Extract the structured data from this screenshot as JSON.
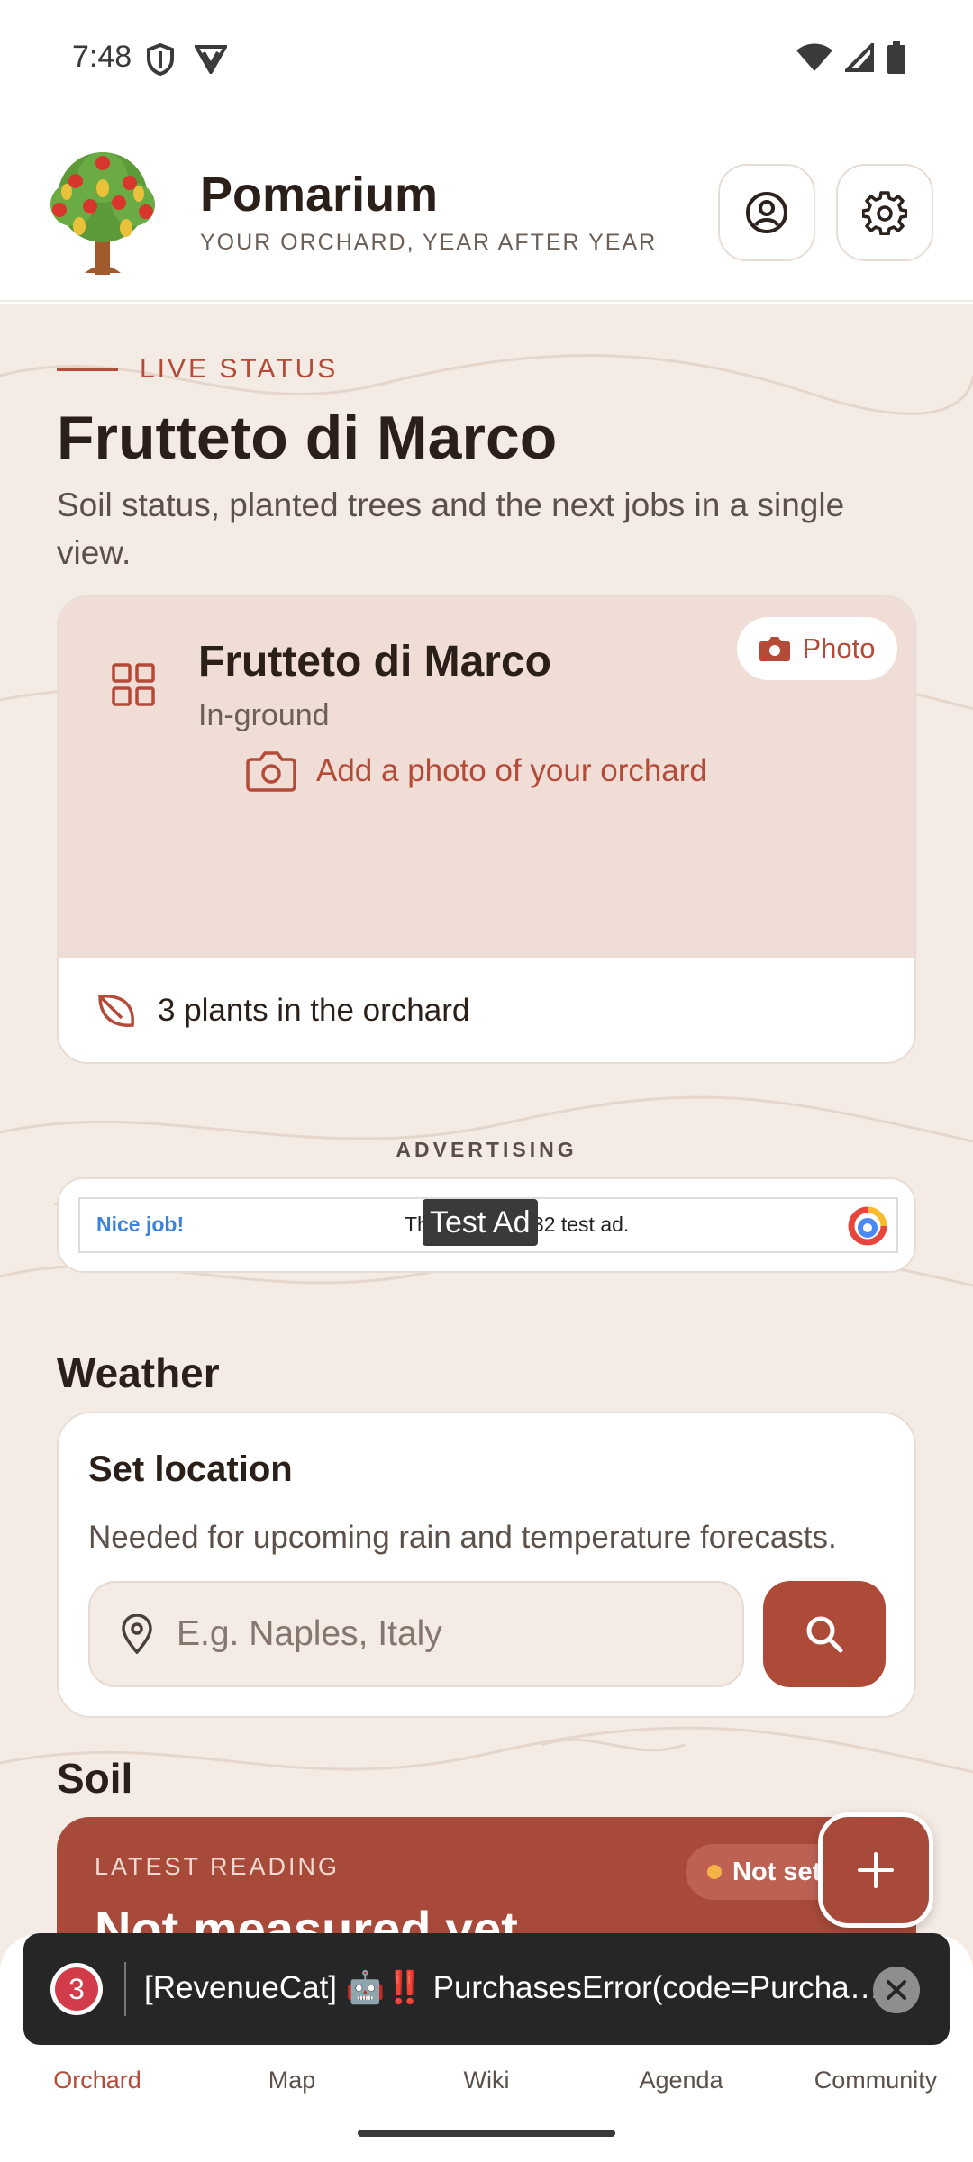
{
  "status_bar": {
    "time": "7:48"
  },
  "app": {
    "title": "Pomarium",
    "subtitle": "YOUR ORCHARD, YEAR AFTER YEAR"
  },
  "hero": {
    "eyebrow": "LIVE STATUS",
    "title": "Frutteto di Marco",
    "description": "Soil status, planted trees and the next jobs in a single view."
  },
  "orchard_card": {
    "name": "Frutteto di Marco",
    "type": "In-ground",
    "photo_button": "Photo",
    "add_photo": "Add a photo of your orchard",
    "plants_summary": "3 plants in the orchard"
  },
  "ad": {
    "label": "ADVERTISING",
    "nice_job": "Nice job!",
    "text": "This is a 320x32 test ad.",
    "badge": "Test Ad"
  },
  "weather": {
    "section_title": "Weather",
    "heading": "Set location",
    "note": "Needed for upcoming rain and temperature forecasts.",
    "input_placeholder": "E.g. Naples, Italy"
  },
  "soil": {
    "section_title": "Soil",
    "label": "LATEST READING",
    "value": "Not measured yet",
    "chip": "Not set"
  },
  "toast": {
    "badge_count": "3",
    "message": "[RevenueCat] 🤖‼️ PurchasesError(code=PurchaseNotAllowedError)"
  },
  "nav": {
    "items": [
      "Orchard",
      "Map",
      "Wiki",
      "Agenda",
      "Community"
    ],
    "active": "Orchard"
  },
  "colors": {
    "accent": "#b44a38",
    "background": "#f4ebe4",
    "soil_card": "#a84a3a"
  }
}
